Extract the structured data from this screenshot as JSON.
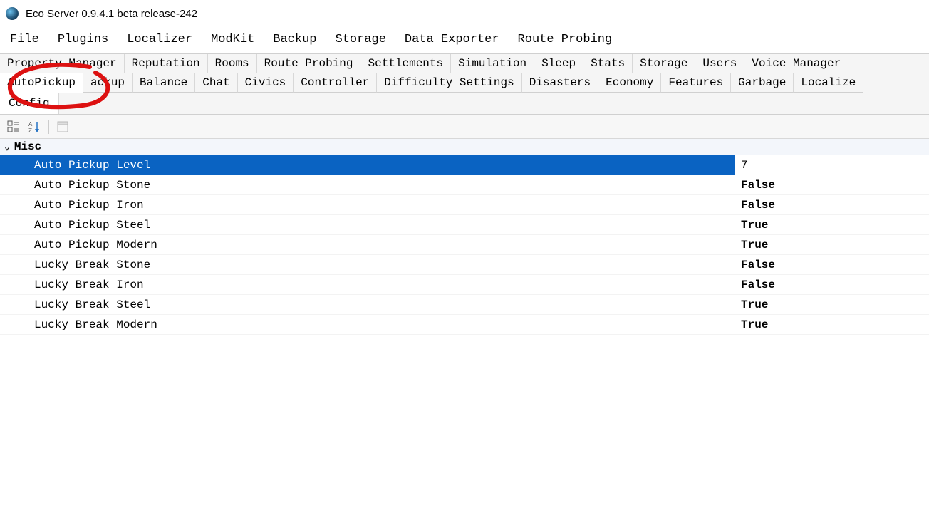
{
  "window": {
    "title": "Eco Server 0.9.4.1 beta release-242"
  },
  "menubar": [
    "File",
    "Plugins",
    "Localizer",
    "ModKit",
    "Backup",
    "Storage",
    "Data Exporter",
    "Route Probing"
  ],
  "tabs_row1": [
    "Property Manager",
    "Reputation",
    "Rooms",
    "Route Probing",
    "Settlements",
    "Simulation",
    "Sleep",
    "Stats",
    "Storage",
    "Users",
    "Voice Manager"
  ],
  "tabs_row2": [
    "AutoPickup",
    "ackup",
    "Balance",
    "Chat",
    "Civics",
    "Controller",
    "Difficulty Settings",
    "Disasters",
    "Economy",
    "Features",
    "Garbage",
    "Localize"
  ],
  "tabs_row2_active_index": 0,
  "subtab": "Config",
  "category": "Misc",
  "properties": [
    {
      "name": "Auto Pickup Level",
      "value": "7",
      "selected": true
    },
    {
      "name": "Auto Pickup Stone",
      "value": "False",
      "selected": false
    },
    {
      "name": "Auto Pickup Iron",
      "value": "False",
      "selected": false
    },
    {
      "name": "Auto Pickup Steel",
      "value": "True",
      "selected": false
    },
    {
      "name": "Auto Pickup Modern",
      "value": "True",
      "selected": false
    },
    {
      "name": "Lucky Break Stone",
      "value": "False",
      "selected": false
    },
    {
      "name": "Lucky Break Iron",
      "value": "False",
      "selected": false
    },
    {
      "name": "Lucky Break Steel",
      "value": "True",
      "selected": false
    },
    {
      "name": "Lucky Break Modern",
      "value": "True",
      "selected": false
    }
  ]
}
